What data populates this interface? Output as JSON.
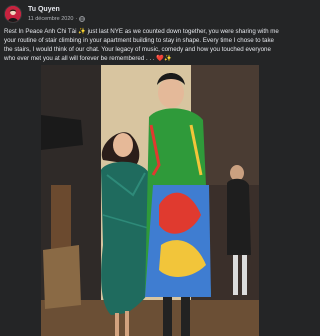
{
  "post": {
    "author": "Tu Quyen",
    "date": "11 décembre 2020",
    "date_separator": "·",
    "caption_lines": [
      "Rest In Peace Anh Chi Tài ✨ just last NYE as we counted down together, you were sharing with me",
      "your routine of stair climbing in your apartment building to stay in shape. Every time I chose to take",
      "the stairs, I would think of our chat. Your legacy of music, comedy and how you touched everyone",
      "who ever met you at all will forever be remembered . . . ❤️✨"
    ]
  },
  "icons": {
    "avatar": "profile-avatar",
    "audience": "globe-icon"
  },
  "colors": {
    "background": "#242526",
    "text": "#e4e6eb",
    "secondary_text": "#b0b3b8"
  }
}
